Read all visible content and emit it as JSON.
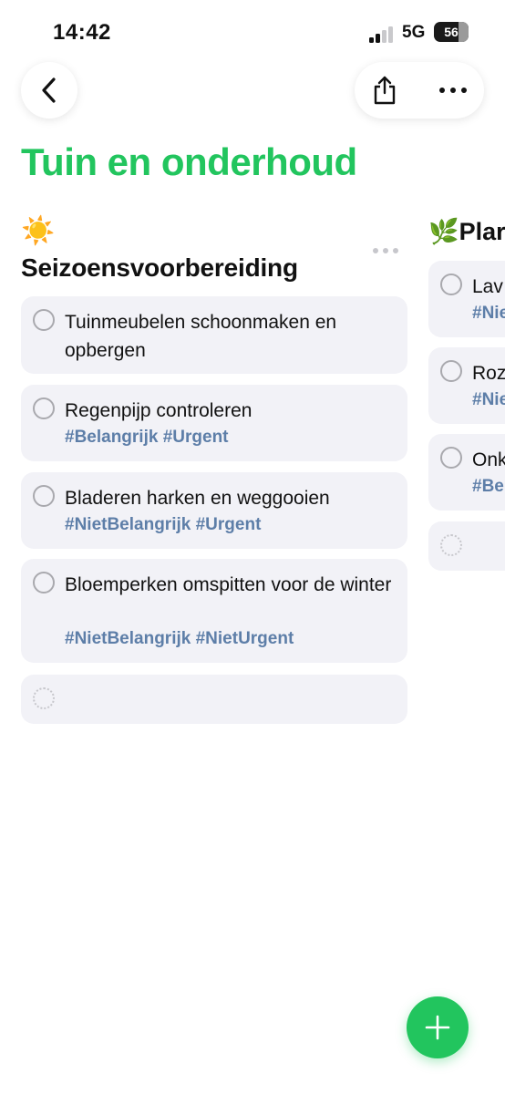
{
  "status_bar": {
    "time": "14:42",
    "network": "5G",
    "battery": "56"
  },
  "nav": {
    "back_icon": "chevron-left-icon",
    "share_icon": "share-icon",
    "more_icon": "ellipsis-icon"
  },
  "page": {
    "title": "Tuin en onderhoud",
    "title_color": "#22c55e"
  },
  "columns": [
    {
      "emoji": "☀️",
      "title": "Seizoensvoorbereiding",
      "tasks": [
        {
          "text": "Tuinmeubelen schoonmaken en opbergen",
          "tags": ""
        },
        {
          "text": "Regenpijp controleren",
          "tags": "#Belangrijk #Urgent"
        },
        {
          "text": "Bladeren harken en weggooien",
          "tags": "#NietBelangrijk #Urgent"
        },
        {
          "text": "Bloemperken omspitten voor de winter",
          "tags": "#NietBelangrijk #NietUrgent"
        }
      ]
    },
    {
      "emoji": "🌿",
      "title": "Plar",
      "tasks": [
        {
          "text": "Lav",
          "tags": "#Nie"
        },
        {
          "text": "Roz",
          "tags": "#Nie"
        },
        {
          "text": "Onk",
          "tags": "#Be"
        }
      ]
    }
  ],
  "fab": {
    "icon": "plus-icon",
    "color": "#22c55e"
  },
  "tag_color": "#5d7ea8"
}
